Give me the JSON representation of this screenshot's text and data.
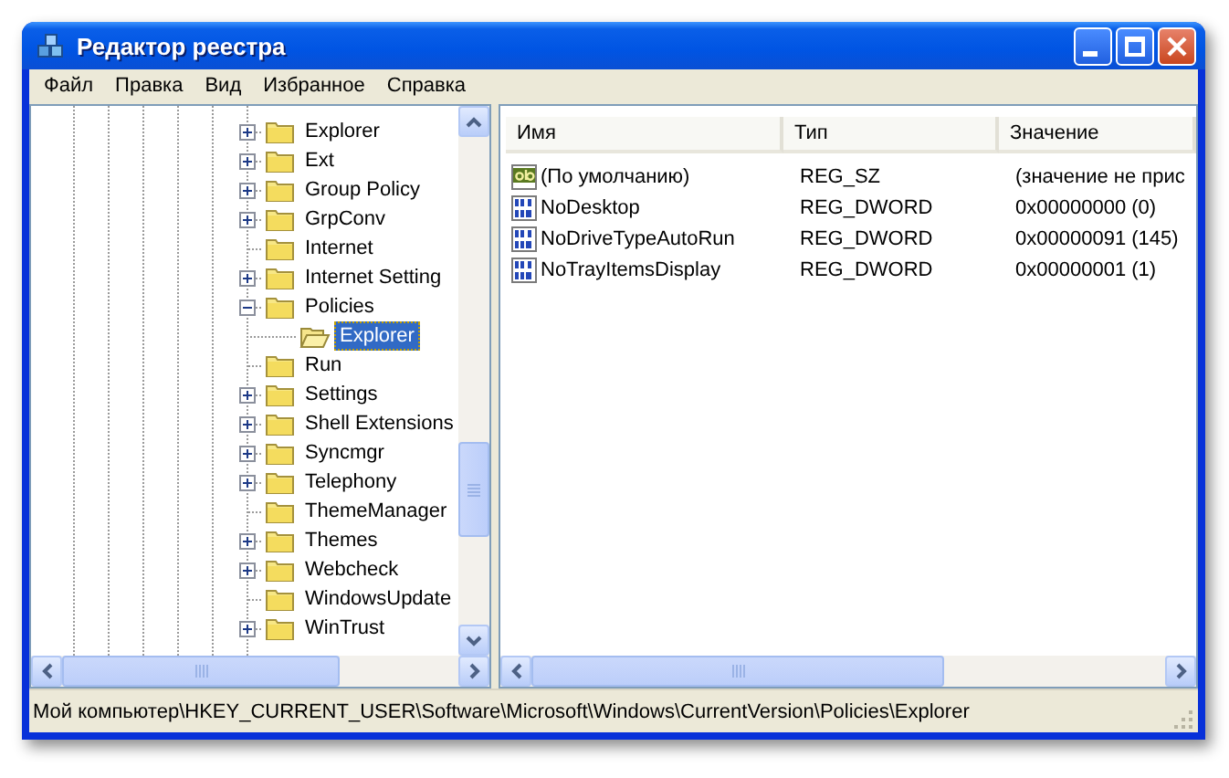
{
  "window": {
    "title": "Редактор реестра"
  },
  "menu": [
    "Файл",
    "Правка",
    "Вид",
    "Избранное",
    "Справка"
  ],
  "tree": [
    {
      "label": "Explorer",
      "expanded": false,
      "selected": false
    },
    {
      "label": "Ext",
      "expanded": false,
      "selected": false
    },
    {
      "label": "Group Policy",
      "expanded": false,
      "selected": false
    },
    {
      "label": "GrpConv",
      "expanded": false,
      "selected": false
    },
    {
      "label": "Internet",
      "selected": false
    },
    {
      "label": "Internet Setting",
      "expanded": false,
      "selected": false
    },
    {
      "label": "Policies",
      "expanded": true,
      "selected": false,
      "children": [
        {
          "label": "Explorer",
          "selected": true
        }
      ]
    },
    {
      "label": "Run",
      "selected": false
    },
    {
      "label": "Settings",
      "expanded": false,
      "selected": false
    },
    {
      "label": "Shell Extensions",
      "expanded": false,
      "selected": false
    },
    {
      "label": "Syncmgr",
      "expanded": false,
      "selected": false
    },
    {
      "label": "Telephony",
      "expanded": false,
      "selected": false
    },
    {
      "label": "ThemeManager",
      "selected": false
    },
    {
      "label": "Themes",
      "expanded": false,
      "selected": false
    },
    {
      "label": "Webcheck",
      "expanded": false,
      "selected": false
    },
    {
      "label": "WindowsUpdate",
      "selected": false
    },
    {
      "label": "WinTrust",
      "expanded": false,
      "selected": false
    }
  ],
  "table": {
    "columns": [
      "Имя",
      "Тип",
      "Значение"
    ],
    "rows": [
      {
        "kind": "string",
        "name": "(По умолчанию)",
        "type": "REG_SZ",
        "value": "(значение не прис"
      },
      {
        "kind": "dword",
        "name": "NoDesktop",
        "type": "REG_DWORD",
        "value": "0x00000000 (0)"
      },
      {
        "kind": "dword",
        "name": "NoDriveTypeAutoRun",
        "type": "REG_DWORD",
        "value": "0x00000091 (145)"
      },
      {
        "kind": "dword",
        "name": "NoTrayItemsDisplay",
        "type": "REG_DWORD",
        "value": "0x00000001 (1)"
      }
    ]
  },
  "status_bar": "Мой компьютер\\HKEY_CURRENT_USER\\Software\\Microsoft\\Windows\\CurrentVersion\\Policies\\Explorer"
}
